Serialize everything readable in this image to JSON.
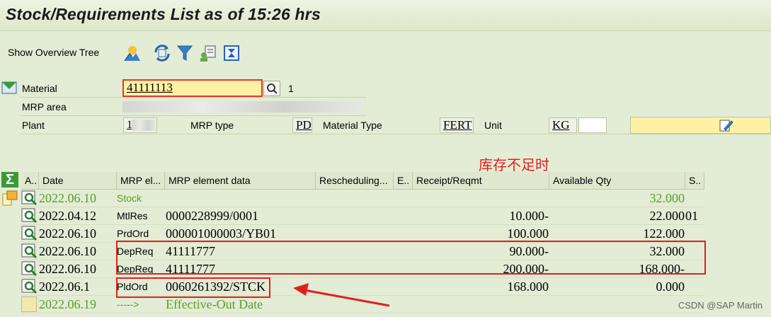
{
  "window": {
    "title": "Stock/Requirements List as of 15:26 hrs"
  },
  "toolbar": {
    "show_overview_tree": "Show Overview Tree",
    "icons": [
      "mrp-element-icon",
      "refresh-icon",
      "filter-icon",
      "user-settings-icon",
      "layout-icon"
    ]
  },
  "header": {
    "material_label": "Material",
    "material_value": "41111113",
    "material_count": "1",
    "mrp_area_label": "MRP area",
    "plant_label": "Plant",
    "plant_value": "1",
    "mrp_type_label": "MRP type",
    "mrp_type_value": "PD",
    "material_type_label": "Material Type",
    "material_type_value": "FERT",
    "unit_label": "Unit",
    "unit_value": "KG"
  },
  "annotation": {
    "text": "库存不足时"
  },
  "grid": {
    "columns": [
      "A..",
      "Date",
      "MRP el...",
      "MRP element data",
      "Rescheduling...",
      "E..",
      "Receipt/Reqmt",
      "Available Qty",
      "S.."
    ],
    "rows": [
      {
        "date": "2022.06.10",
        "element": "Stock",
        "data": "",
        "receipt": "",
        "available": "32.000",
        "s": "",
        "style": "green"
      },
      {
        "date": "2022.04.12",
        "element": "MtlRes",
        "data": "0000228999/0001",
        "receipt": "10.000-",
        "available": "22.000",
        "s": "01",
        "style": "normal"
      },
      {
        "date": "2022.06.10",
        "element": "PrdOrd",
        "data": "000001000003/YB01",
        "receipt": "100.000",
        "available": "122.000",
        "s": "",
        "style": "normal"
      },
      {
        "date": "2022.06.10",
        "element": "DepReq",
        "data": "41111777",
        "receipt": "90.000-",
        "available": "32.000",
        "s": "",
        "style": "normal"
      },
      {
        "date": "2022.06.10",
        "element": "DepReq",
        "data": "41111777",
        "receipt": "200.000-",
        "available": "168.000-",
        "s": "",
        "style": "normal"
      },
      {
        "date": "2022.06.1",
        "element": "PldOrd",
        "data": "0060261392/STCK",
        "receipt": "168.000",
        "available": "0.000",
        "s": "",
        "style": "normal"
      },
      {
        "date": "2022.06.19",
        "element": "----->",
        "data": "Effective-Out Date",
        "receipt": "",
        "available": "",
        "s": "",
        "style": "green"
      }
    ]
  },
  "watermark": "CSDN @SAP Martin",
  "colors": {
    "accent_red": "#e02020",
    "green_text": "#5a9d2a",
    "highlight_field": "#fdf2a4"
  }
}
